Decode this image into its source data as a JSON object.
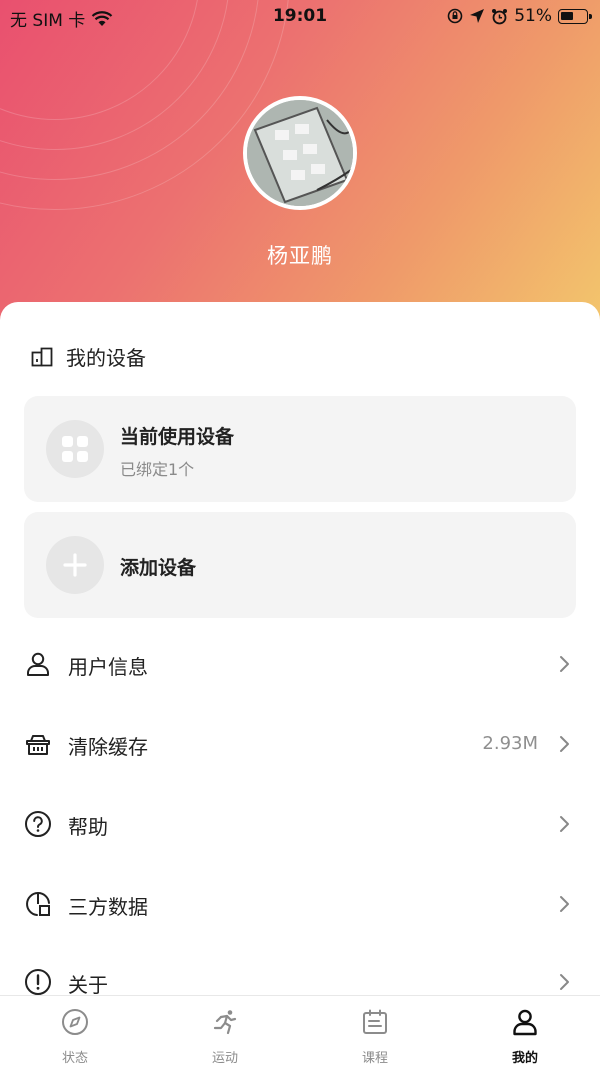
{
  "status_bar": {
    "carrier": "无 SIM 卡",
    "time": "19:01",
    "battery": "51%",
    "battery_level": 0.51
  },
  "profile": {
    "username": "杨亚鹏"
  },
  "my_devices": {
    "title": "我的设备",
    "current": {
      "title": "当前使用设备",
      "subtitle": "已绑定1个"
    },
    "add": {
      "title": "添加设备"
    }
  },
  "menu": [
    {
      "label": "用户信息",
      "value": "",
      "icon": "user-icon"
    },
    {
      "label": "清除缓存",
      "value": "2.93M",
      "icon": "basket-icon"
    },
    {
      "label": "帮助",
      "value": "",
      "icon": "help-circle-icon"
    },
    {
      "label": "三方数据",
      "value": "",
      "icon": "third-party-data-icon"
    },
    {
      "label": "关于",
      "value": "",
      "icon": "info-exclamation-icon"
    }
  ],
  "tabbar": {
    "tabs": [
      {
        "label": "状态",
        "icon": "compass-icon",
        "active": false
      },
      {
        "label": "运动",
        "icon": "running-icon",
        "active": false
      },
      {
        "label": "课程",
        "icon": "course-icon",
        "active": false
      },
      {
        "label": "我的",
        "icon": "profile-icon",
        "active": true
      }
    ]
  },
  "colors": {
    "gradient_start": "#e9506f",
    "gradient_end": "#f3c66c",
    "card_bg": "#f4f4f4",
    "muted_text": "#8a8a8a"
  }
}
